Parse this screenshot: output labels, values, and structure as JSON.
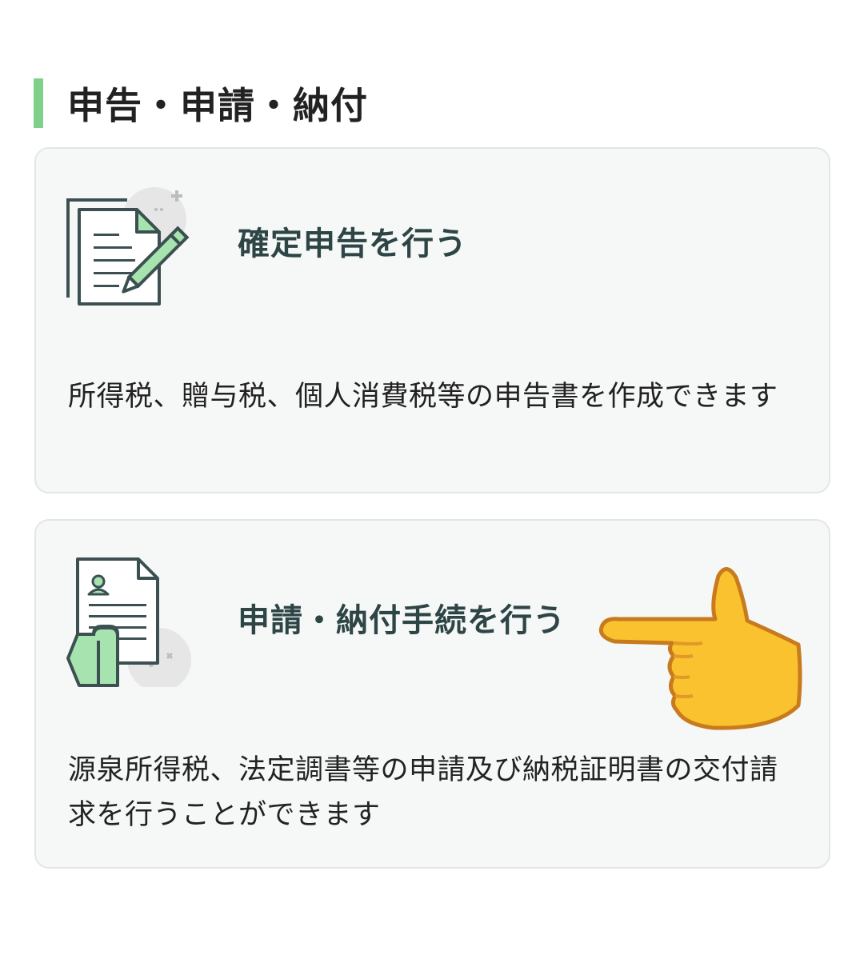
{
  "section": {
    "heading": "申告・申請・納付",
    "accent_color": "#7fd08a"
  },
  "cards": [
    {
      "title": "確定申告を行う",
      "description": "所得税、贈与税、個人消費税等の申告書を作成できます",
      "icon": "document-with-pencil-icon"
    },
    {
      "title": "申請・納付手続を行う",
      "description": "源泉所得税、法定調書等の申請及び納税証明書の交付請求を行うことができます",
      "icon": "hand-holding-profile-document-icon"
    }
  ],
  "overlay": {
    "icon": "pointing-right-hand-emoji"
  }
}
